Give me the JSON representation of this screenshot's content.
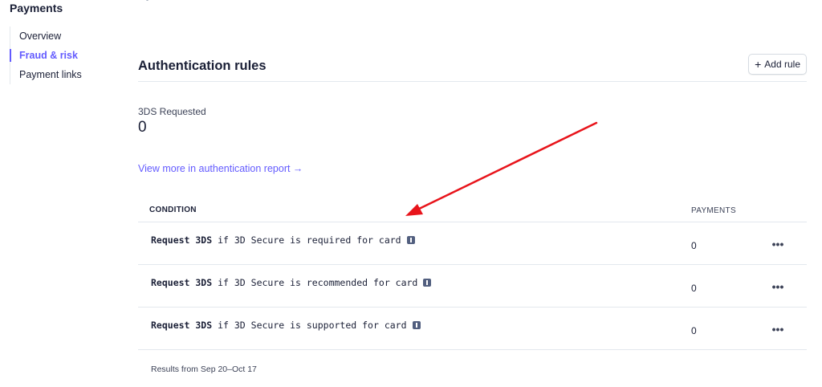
{
  "sidebar": {
    "title": "Payments",
    "items": [
      {
        "label": "Overview",
        "active": false
      },
      {
        "label": "Fraud & risk",
        "active": true
      },
      {
        "label": "Payment links",
        "active": false
      }
    ]
  },
  "header": {
    "title": "Authentication rules",
    "add_rule_label": "Add rule"
  },
  "metric": {
    "label": "3DS Requested",
    "value": "0"
  },
  "report_link": "View more in authentication report →",
  "table": {
    "columns": {
      "condition": "CONDITION",
      "payments": "PAYMENTS"
    },
    "rows": [
      {
        "action": "Request 3DS",
        "condition": "if 3D Secure is required for card",
        "payments": "0"
      },
      {
        "action": "Request 3DS",
        "condition": "if 3D Secure is recommended for card",
        "payments": "0"
      },
      {
        "action": "Request 3DS",
        "condition": "if 3D Secure is supported for card",
        "payments": "0"
      }
    ],
    "more_label": "•••"
  },
  "results_note": "Results from Sep 20–Oct 17",
  "colors": {
    "accent": "#635bff",
    "annotation_arrow": "#e8141b"
  },
  "icons": {
    "add": "plus-icon",
    "info": "info-icon",
    "more": "more-icon"
  }
}
